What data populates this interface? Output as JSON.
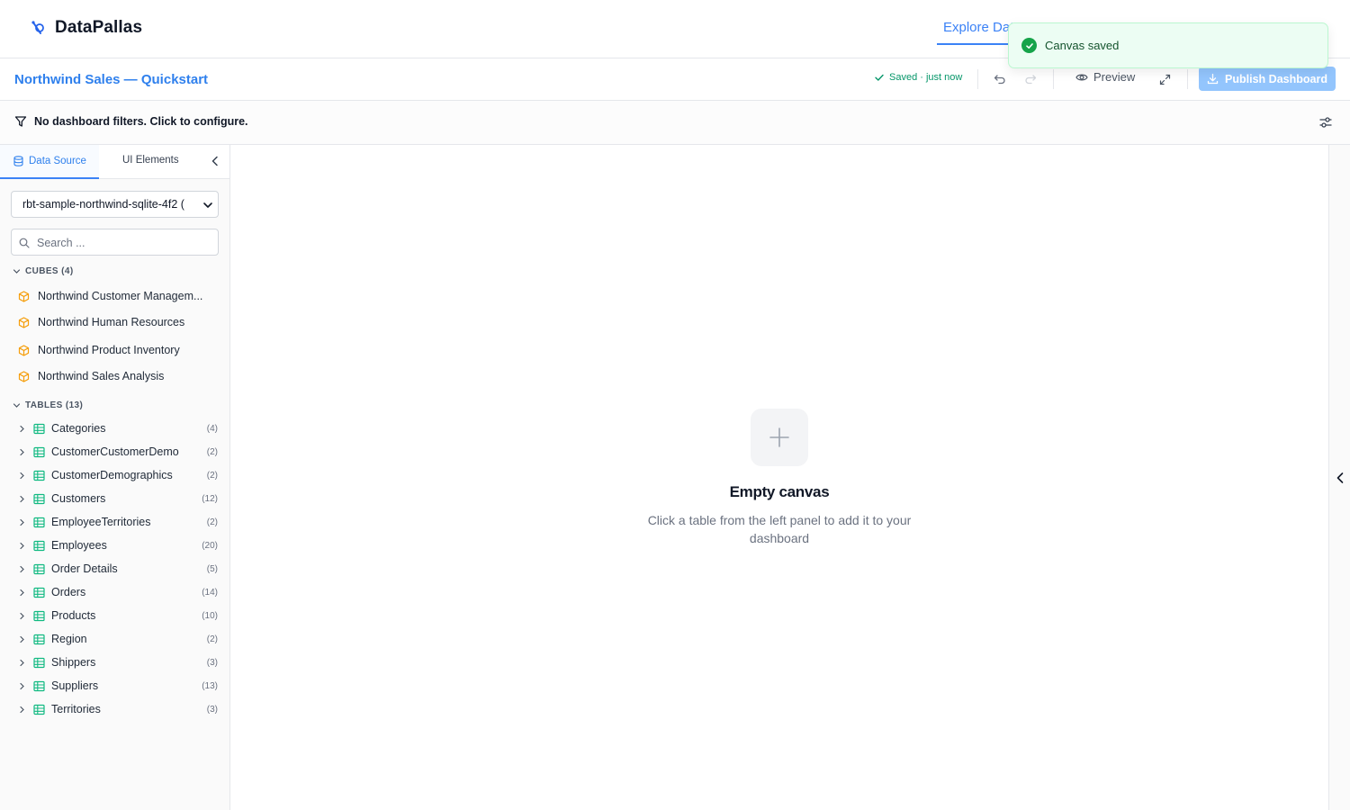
{
  "app": {
    "name": "DataPallas"
  },
  "nav": {
    "active_tab": "Explore Data"
  },
  "toast": {
    "message": "Canvas saved"
  },
  "dashboard": {
    "title": "Northwind Sales — Quickstart",
    "save_status": "Saved · just now",
    "preview_label": "Preview",
    "publish_label": "Publish Dashboard"
  },
  "filters": {
    "message": "No dashboard filters. Click to configure."
  },
  "sidebar": {
    "tabs": {
      "data_source": "Data Source",
      "ui_elements": "UI Elements"
    },
    "datasource_selected": "rbt-sample-northwind-sqlite-4f2 (",
    "search_placeholder": "Search ...",
    "cubes_header": "CUBES (4)",
    "cubes": [
      {
        "label": "Northwind Customer Managem..."
      },
      {
        "label": "Northwind Human Resources"
      },
      {
        "label": "Northwind Product Inventory"
      },
      {
        "label": "Northwind Sales Analysis"
      }
    ],
    "tables_header": "TABLES (13)",
    "tables": [
      {
        "name": "Categories",
        "count": "(4)"
      },
      {
        "name": "CustomerCustomerDemo",
        "count": "(2)"
      },
      {
        "name": "CustomerDemographics",
        "count": "(2)"
      },
      {
        "name": "Customers",
        "count": "(12)"
      },
      {
        "name": "EmployeeTerritories",
        "count": "(2)"
      },
      {
        "name": "Employees",
        "count": "(20)"
      },
      {
        "name": "Order Details",
        "count": "(5)"
      },
      {
        "name": "Orders",
        "count": "(14)"
      },
      {
        "name": "Products",
        "count": "(10)"
      },
      {
        "name": "Region",
        "count": "(2)"
      },
      {
        "name": "Shippers",
        "count": "(3)"
      },
      {
        "name": "Suppliers",
        "count": "(13)"
      },
      {
        "name": "Territories",
        "count": "(3)"
      }
    ]
  },
  "canvas": {
    "empty_title": "Empty canvas",
    "empty_subtitle": "Click a table from the left panel to add it to your dashboard"
  },
  "colors": {
    "accent": "#3b82f6",
    "publish_disabled": "#93c5fd",
    "success": "#16a34a",
    "cube_icon": "#f59e0b",
    "table_icon": "#10b981"
  }
}
